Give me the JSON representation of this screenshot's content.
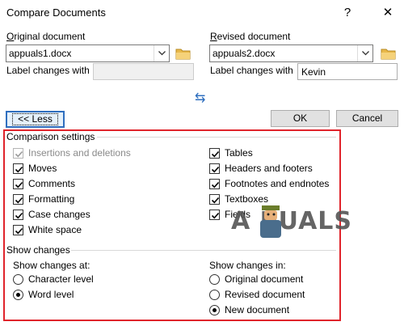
{
  "window": {
    "title": "Compare Documents",
    "help_glyph": "?",
    "close_glyph": "✕"
  },
  "original": {
    "heading": "Original document",
    "file_value": "appuals1.docx",
    "label_changes_with": "Label changes with",
    "label_value": ""
  },
  "revised": {
    "heading": "Revised document",
    "file_value": "appuals2.docx",
    "label_changes_with": "Label changes with",
    "label_value": "Kevin"
  },
  "swap_glyph": "⇆",
  "buttons": {
    "less": "<< Less",
    "ok": "OK",
    "cancel": "Cancel"
  },
  "comparison": {
    "heading": "Comparison settings",
    "left": [
      {
        "label": "Insertions and deletions",
        "checked": true,
        "disabled": true
      },
      {
        "label": "Moves",
        "checked": true,
        "disabled": false
      },
      {
        "label": "Comments",
        "checked": true,
        "disabled": false
      },
      {
        "label": "Formatting",
        "checked": true,
        "disabled": false
      },
      {
        "label": "Case changes",
        "checked": true,
        "disabled": false
      },
      {
        "label": "White space",
        "checked": true,
        "disabled": false
      }
    ],
    "right": [
      {
        "label": "Tables",
        "checked": true
      },
      {
        "label": "Headers and footers",
        "checked": true
      },
      {
        "label": "Footnotes and endnotes",
        "checked": true
      },
      {
        "label": "Textboxes",
        "checked": true
      },
      {
        "label": "Fields",
        "checked": true
      }
    ]
  },
  "show_changes": {
    "heading": "Show changes",
    "at_heading": "Show changes at:",
    "at_options": [
      {
        "label": "Character level",
        "selected": false
      },
      {
        "label": "Word level",
        "selected": true
      }
    ],
    "in_heading": "Show changes in:",
    "in_options": [
      {
        "label": "Original document",
        "selected": false
      },
      {
        "label": "Revised document",
        "selected": false
      },
      {
        "label": "New document",
        "selected": true
      }
    ]
  },
  "watermark": {
    "text": "A PUALS"
  },
  "colors": {
    "highlight_frame": "#e0242b",
    "focus_button": "#2f6fbf",
    "folder": "#e8b84a"
  }
}
